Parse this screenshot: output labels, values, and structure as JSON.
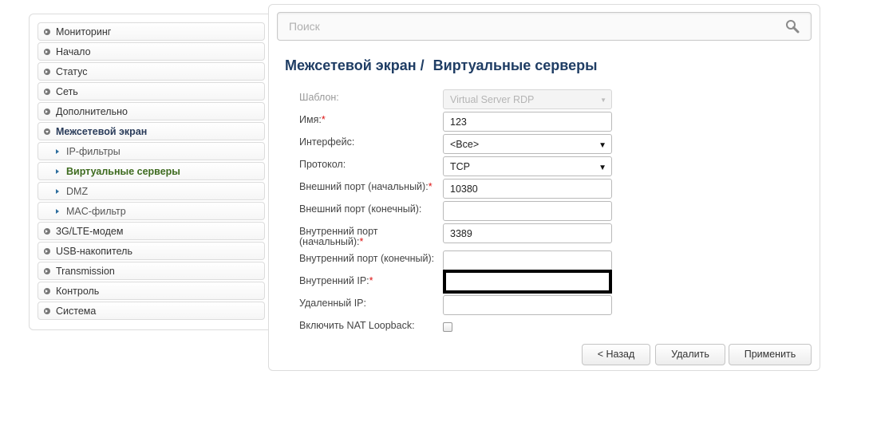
{
  "sidebar": {
    "items": [
      {
        "label": "Мониторинг"
      },
      {
        "label": "Начало"
      },
      {
        "label": "Статус"
      },
      {
        "label": "Сеть"
      },
      {
        "label": "Дополнительно"
      },
      {
        "label": "Межсетевой экран",
        "expanded": true
      },
      {
        "label": "IP-фильтры",
        "sub": true
      },
      {
        "label": "Виртуальные серверы",
        "sub": true,
        "active": true
      },
      {
        "label": "DMZ",
        "sub": true
      },
      {
        "label": "MAC-фильтр",
        "sub": true
      },
      {
        "label": "3G/LTE-модем"
      },
      {
        "label": "USB-накопитель"
      },
      {
        "label": "Transmission"
      },
      {
        "label": "Контроль"
      },
      {
        "label": "Система"
      }
    ]
  },
  "search": {
    "placeholder": "Поиск",
    "value": "",
    "icon": "search-icon"
  },
  "page": {
    "breadcrumb_parent": "Межсетевой экран /",
    "title": "Виртуальные серверы"
  },
  "form": {
    "template": {
      "label": "Шаблон:",
      "value": "Virtual Server RDP",
      "disabled": true
    },
    "name": {
      "label": "Имя:",
      "required": "*",
      "value": "123"
    },
    "interface": {
      "label": "Интерфейс:",
      "value": "<Все>"
    },
    "protocol": {
      "label": "Протокол:",
      "value": "TCP"
    },
    "ext_port_start": {
      "label": "Внешний порт (начальный):",
      "required": "*",
      "value": "10380"
    },
    "ext_port_end": {
      "label": "Внешний порт (конечный):",
      "value": ""
    },
    "int_port_start": {
      "label": "Внутренний порт (начальный):",
      "required": "*",
      "value": "3389"
    },
    "int_port_end": {
      "label": "Внутренний порт (конечный):",
      "value": ""
    },
    "internal_ip": {
      "label": "Внутренний IP:",
      "required": "*",
      "value": "",
      "redacted": true
    },
    "remote_ip": {
      "label": "Удаленный IP:",
      "value": ""
    },
    "nat_loopback": {
      "label": "Включить NAT Loopback:",
      "checked": false
    }
  },
  "buttons": {
    "back": "< Назад",
    "delete": "Удалить",
    "apply": "Применить"
  },
  "colors": {
    "title": "#1f3d64",
    "active_menu": "#3e6b1f",
    "required": "#dd1111"
  }
}
